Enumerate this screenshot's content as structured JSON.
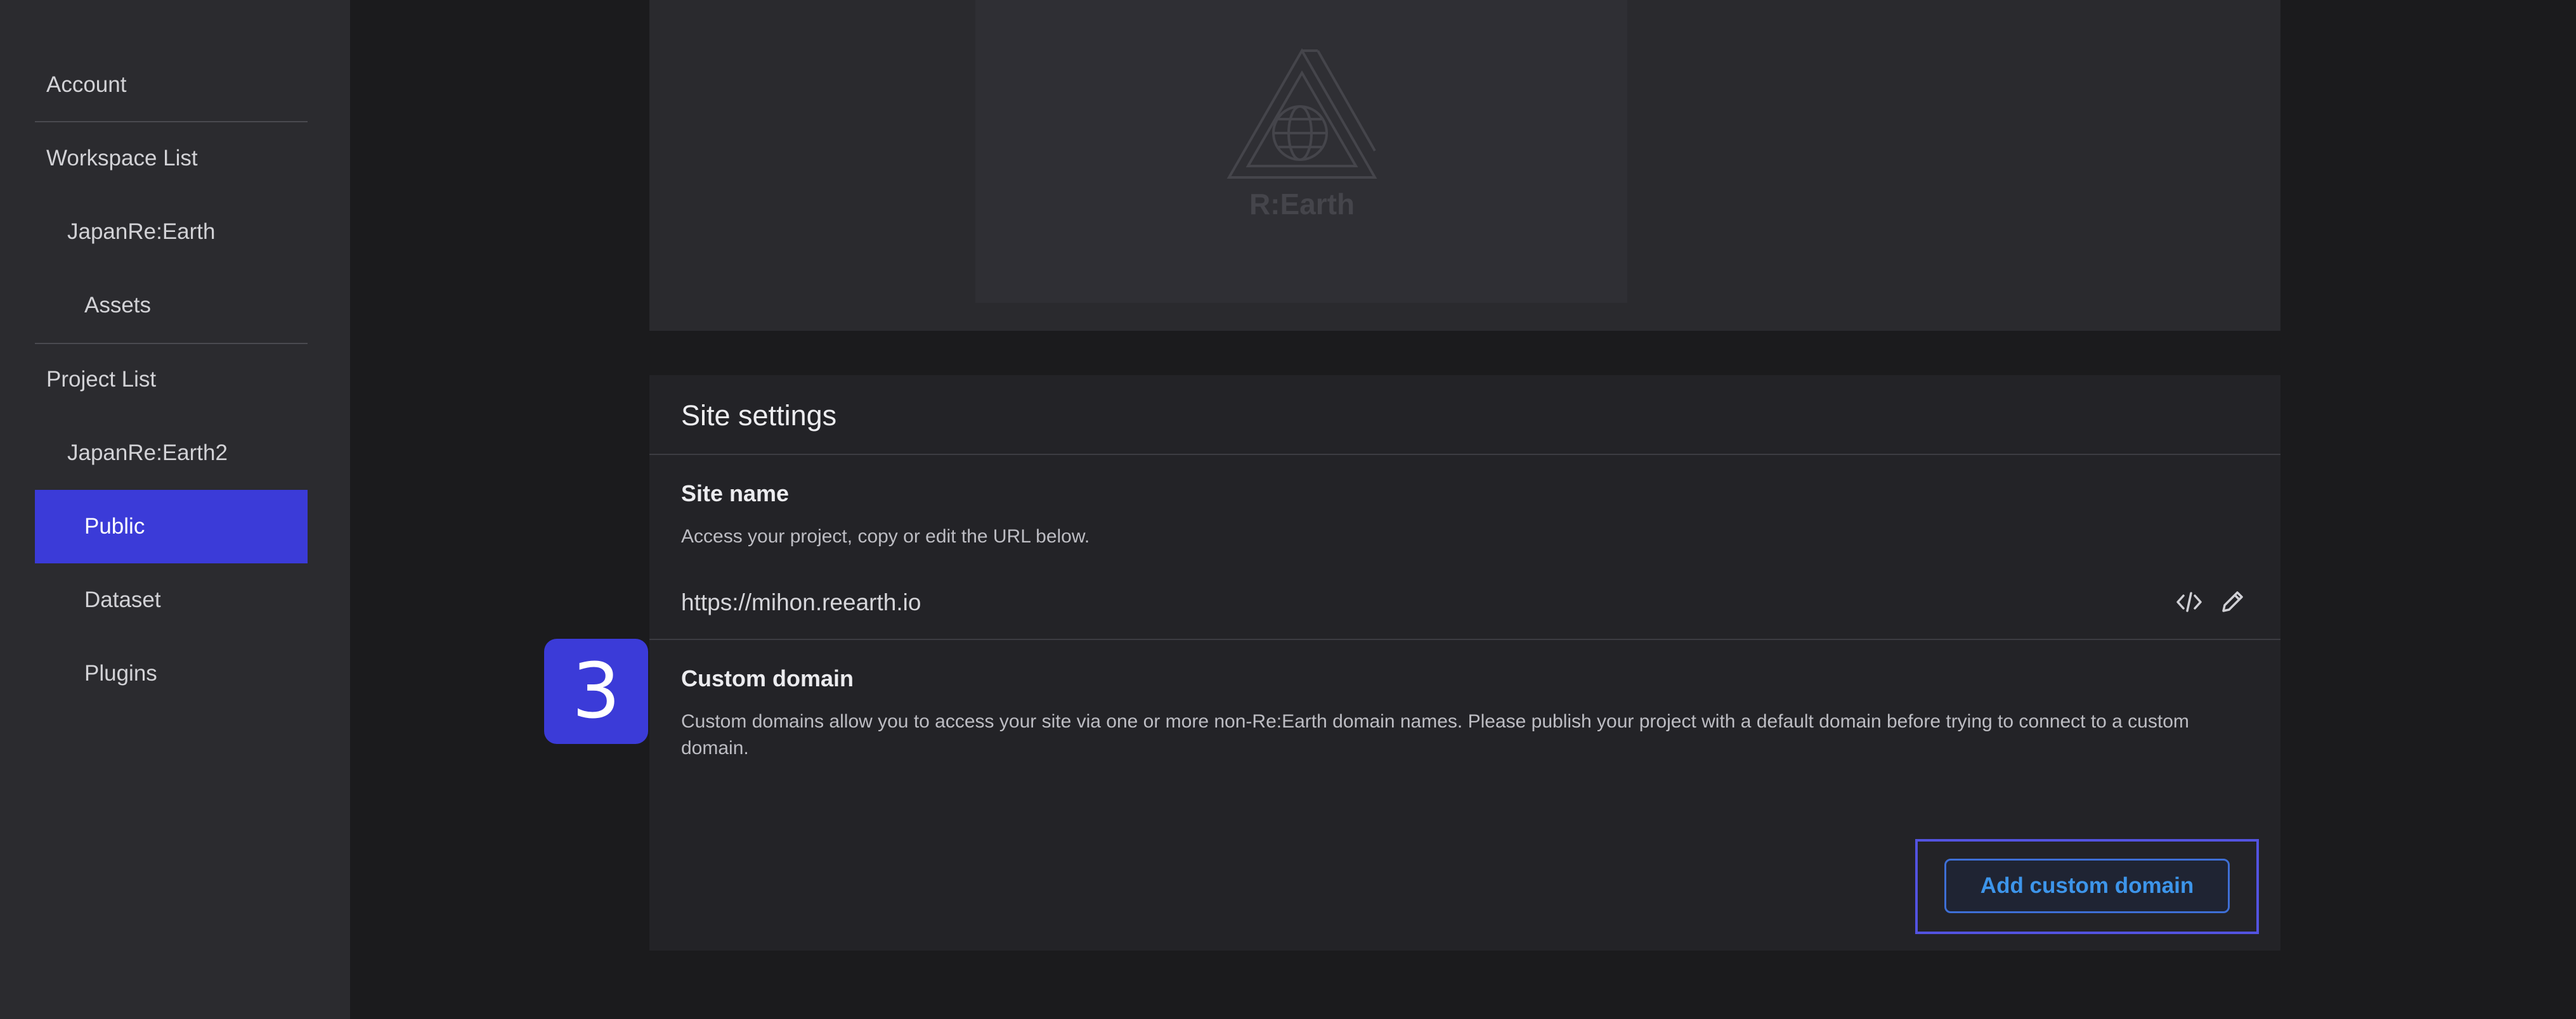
{
  "sidebar": {
    "items": [
      {
        "label": "Account"
      },
      {
        "label": "Workspace List"
      },
      {
        "label": "JapanRe:Earth"
      },
      {
        "label": "Assets"
      },
      {
        "label": "Project List"
      },
      {
        "label": "JapanRe:Earth2"
      },
      {
        "label": "Public"
      },
      {
        "label": "Dataset"
      },
      {
        "label": "Plugins"
      }
    ]
  },
  "preview": {
    "logo_text": "R:Earth"
  },
  "site_settings": {
    "title": "Site settings",
    "site_name": {
      "title": "Site name",
      "description": "Access your project, copy or edit the URL below.",
      "url": "https://mihon.reearth.io",
      "icons": [
        "code-icon",
        "pencil-icon"
      ]
    },
    "custom_domain": {
      "title": "Custom domain",
      "description": "Custom domains allow you to access your site via one or more non-Re:Earth domain names. Please publish your project with a default domain before trying to connect to a custom domain.",
      "button_label": "Add custom domain"
    }
  },
  "step_badge": {
    "number": "3"
  },
  "colors": {
    "accent": "#3b3bd8",
    "button_text": "#3d95ea",
    "background": "#1b1b1d",
    "sidebar": "#2b2b2f",
    "panel": "#232327"
  }
}
